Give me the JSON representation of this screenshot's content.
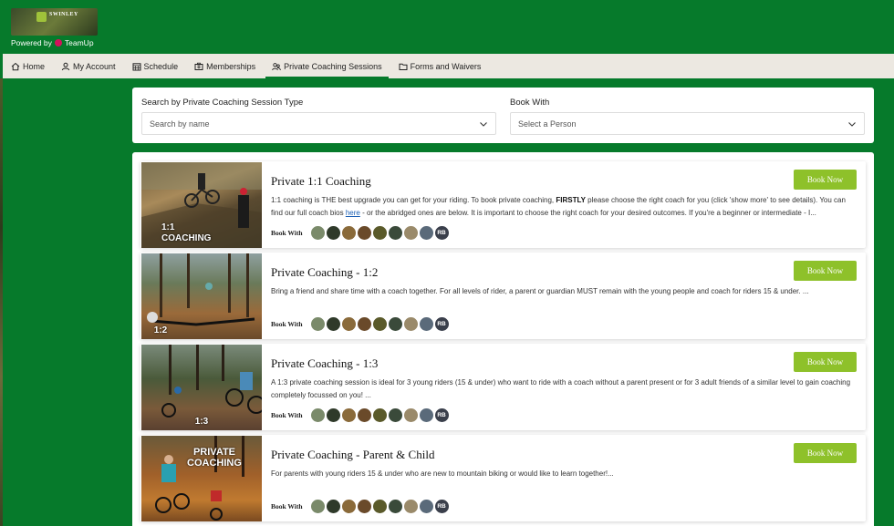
{
  "header": {
    "logo_text": "SWINLEY",
    "powered_prefix": "Powered by",
    "powered_brand": "TeamUp"
  },
  "nav": [
    {
      "label": "Home",
      "icon": "home-icon"
    },
    {
      "label": "My Account",
      "icon": "user-icon"
    },
    {
      "label": "Schedule",
      "icon": "calendar-icon"
    },
    {
      "label": "Memberships",
      "icon": "membership-card-icon"
    },
    {
      "label": "Private Coaching Sessions",
      "icon": "group-icon",
      "active": true
    },
    {
      "label": "Forms and Waivers",
      "icon": "folder-icon"
    }
  ],
  "filters": {
    "type_label": "Search by Private Coaching Session Type",
    "type_placeholder": "Search by name",
    "book_label": "Book With",
    "book_placeholder": "Select a Person"
  },
  "sessions": [
    {
      "title": "Private 1:1 Coaching",
      "button": "Book Now",
      "thumb_caption": "1:1 COACHING",
      "desc_1": "1:1 coaching is THE best upgrade you can get for your riding. To book private coaching, ",
      "desc_bold": "FIRSTLY",
      "desc_2": " please choose the right coach for you (click 'show more' to see details). You can find our full coach bios ",
      "desc_link": "here",
      "desc_3": " - or the abridged ones are below. It is important to choose the right coach for your desired outcomes. If you're a beginner or intermediate - I...",
      "book_with": "Book With"
    },
    {
      "title": "Private Coaching - 1:2",
      "button": "Book Now",
      "thumb_caption": "1:2",
      "desc": "Bring a friend and share time with a coach together. For all levels of rider, a parent or guardian MUST remain with the young people and coach for riders 15 & under. ...",
      "book_with": "Book With"
    },
    {
      "title": "Private Coaching - 1:3",
      "button": "Book Now",
      "thumb_caption": "1:3",
      "desc": "A 1:3 private coaching session is ideal for 3 young riders (15 & under) who want to ride with a coach without a parent present or for 3 adult friends of a similar level to gain coaching completely focussed on you! ...",
      "book_with": "Book With"
    },
    {
      "title": "Private Coaching - Parent & Child",
      "button": "Book Now",
      "thumb_caption": "PRIVATE COACHING",
      "desc": "For parents with young riders 15 & under who are new to mountain biking or would like to learn together!...",
      "book_with": "Book With"
    }
  ],
  "coach_initials": "RB",
  "colors": {
    "brand_green": "#067a2b",
    "button_green": "#8ec12a",
    "nav_bg": "#ece8e1"
  }
}
